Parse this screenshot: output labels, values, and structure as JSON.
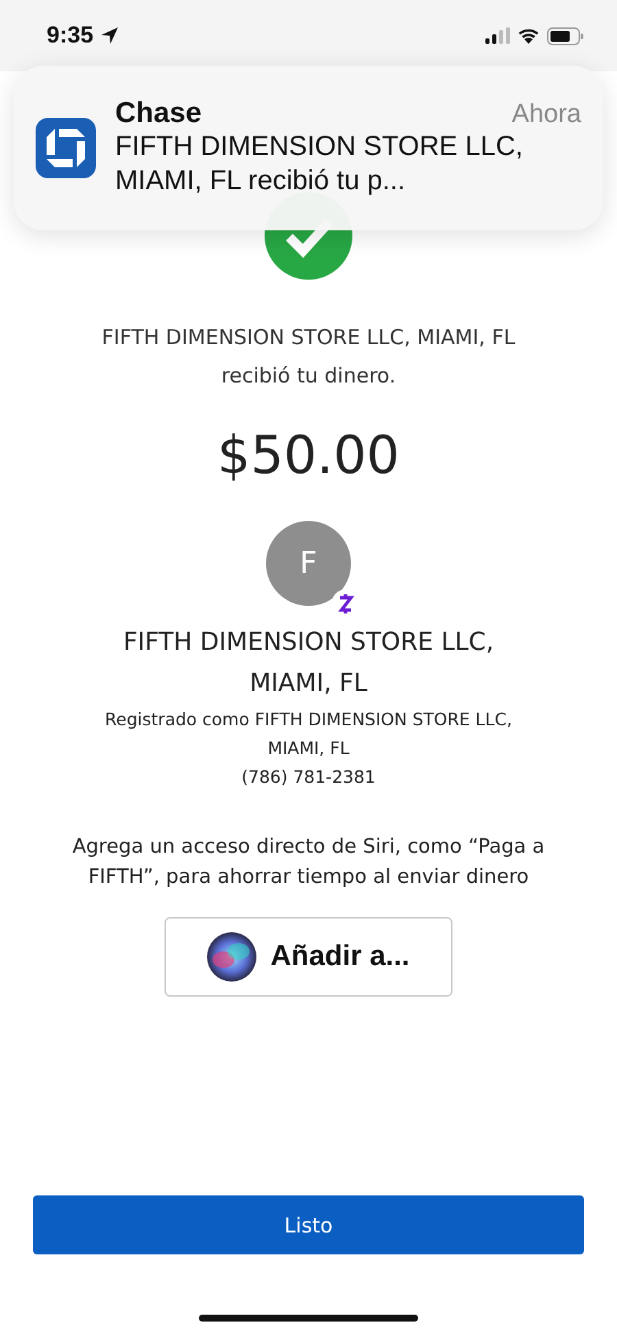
{
  "status_bar": {
    "time": "9:35"
  },
  "notification": {
    "app": "Chase",
    "time": "Ahora",
    "message": "FIFTH DIMENSION STORE LLC, MIAMI, FL recibió tu p..."
  },
  "confirmation": {
    "message": "FIFTH DIMENSION STORE LLC, MIAMI, FL recibió tu dinero.",
    "amount": "$50.00"
  },
  "recipient": {
    "initial": "F",
    "name": "FIFTH DIMENSION STORE LLC, MIAMI, FL",
    "registered_as": "Registrado como FIFTH DIMENSION STORE LLC, MIAMI, FL",
    "phone": "(786) 781-2381"
  },
  "siri": {
    "prompt": "Agrega un acceso directo de Siri, como “Paga a FIFTH”, para ahorrar tiempo al enviar dinero",
    "button": "Añadir a..."
  },
  "done_button": "Listo"
}
